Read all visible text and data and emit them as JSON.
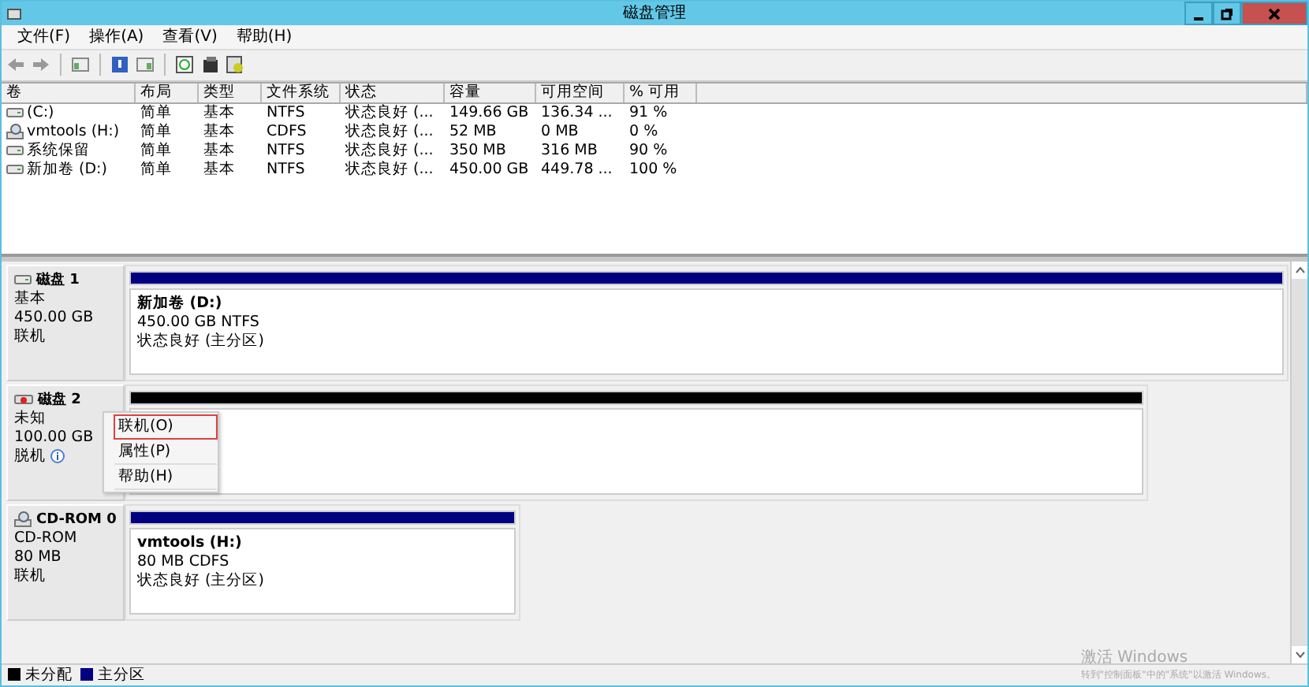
{
  "window": {
    "title": "磁盘管理"
  },
  "menu": [
    "文件(F)",
    "操作(A)",
    "查看(V)",
    "帮助(H)"
  ],
  "table": {
    "columns": [
      "卷",
      "布局",
      "类型",
      "文件系统",
      "状态",
      "容量",
      "可用空间",
      "% 可用"
    ],
    "rows": [
      {
        "kind": "drive",
        "cells": [
          "(C:)",
          "简单",
          "基本",
          "NTFS",
          "状态良好 (...",
          "149.66 GB",
          "136.34 ...",
          "91 %"
        ]
      },
      {
        "kind": "cd",
        "cells": [
          "vmtools (H:)",
          "简单",
          "基本",
          "CDFS",
          "状态良好 (...",
          "52 MB",
          "0 MB",
          "0 %"
        ]
      },
      {
        "kind": "drive",
        "cells": [
          "系统保留",
          "简单",
          "基本",
          "NTFS",
          "状态良好 (...",
          "350 MB",
          "316 MB",
          "90 %"
        ]
      },
      {
        "kind": "drive",
        "cells": [
          "新加卷 (D:)",
          "简单",
          "基本",
          "NTFS",
          "状态良好 (...",
          "450.00 GB",
          "449.78 ...",
          "100 %"
        ]
      }
    ]
  },
  "disks": [
    {
      "kind": "disk",
      "name": "磁盘 1",
      "lines": [
        "基本",
        "450.00 GB",
        "联机"
      ],
      "info": false,
      "partitions": [
        {
          "color": "#000080",
          "name": "新加卷  (D:)",
          "lines": [
            "450.00 GB NTFS",
            "状态良好 (主分区)"
          ]
        }
      ]
    },
    {
      "kind": "offline",
      "name": "磁盘 2",
      "lines": [
        "未知",
        "100.00 GB",
        "脱机"
      ],
      "info": true,
      "partitions": [
        {
          "color": "#000000"
        }
      ]
    },
    {
      "kind": "cd",
      "name": "CD-ROM 0",
      "lines": [
        "CD-ROM",
        "80 MB",
        "联机"
      ],
      "info": false,
      "partitions": [
        {
          "color": "#000080",
          "name": "vmtools  (H:)",
          "lines": [
            "80 MB CDFS",
            "状态良好 (主分区)"
          ]
        }
      ]
    }
  ],
  "context_menu": [
    {
      "label": "联机(O)",
      "selected": true
    },
    {
      "label": "属性(P)",
      "selected": false
    },
    {
      "label": "帮助(H)",
      "selected": false
    }
  ],
  "legend": [
    {
      "label": "未分配",
      "color": "#000000"
    },
    {
      "label": "主分区",
      "color": "#000080"
    }
  ],
  "activation": {
    "title": "激活 Windows",
    "text": "转到\"控制面板\"中的\"系统\"以激活 Windows。"
  }
}
